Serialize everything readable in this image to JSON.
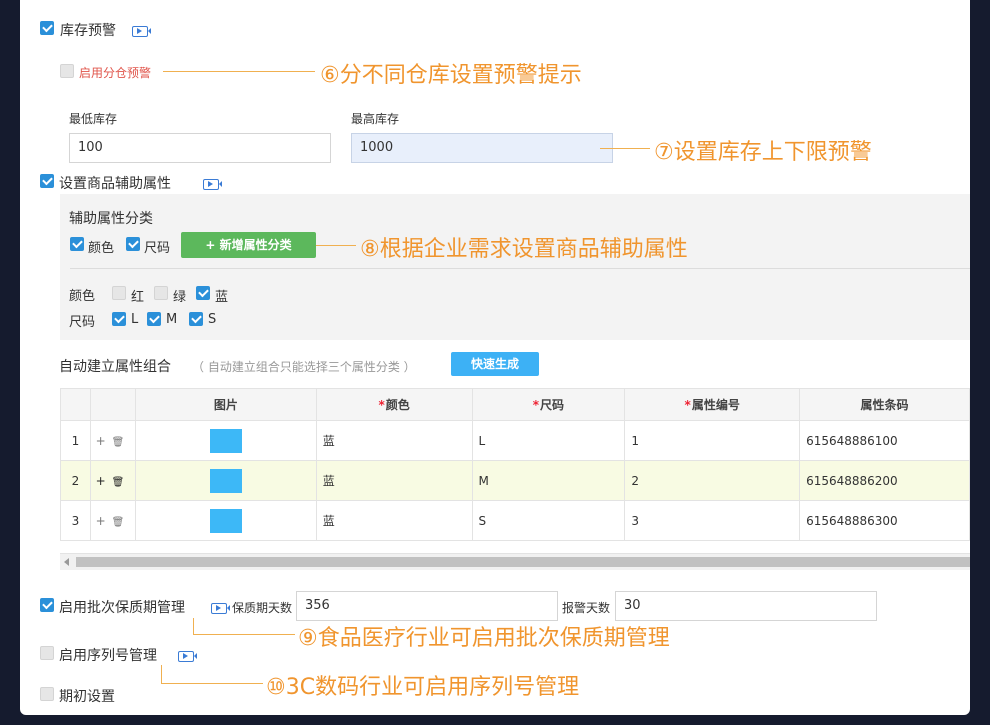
{
  "inventory_alert": {
    "label": "库存预警",
    "checked": true
  },
  "warehouse_alert": {
    "label": "启用分仓预警",
    "checked": false
  },
  "min_stock": {
    "label": "最低库存",
    "value": "100"
  },
  "max_stock": {
    "label": "最高库存",
    "value": "1000"
  },
  "aux_attr": {
    "label": "设置商品辅助属性",
    "checked": true
  },
  "aux_category": {
    "title": "辅助属性分类",
    "options": [
      {
        "label": "颜色",
        "checked": true
      },
      {
        "label": "尺码",
        "checked": true
      }
    ],
    "add_button": "+ 新增属性分类"
  },
  "attr_values": {
    "color": {
      "label": "颜色",
      "values": [
        {
          "label": "红",
          "checked": false
        },
        {
          "label": "绿",
          "checked": false
        },
        {
          "label": "蓝",
          "checked": true
        }
      ]
    },
    "size": {
      "label": "尺码",
      "values": [
        {
          "label": "L",
          "checked": true
        },
        {
          "label": "M",
          "checked": true
        },
        {
          "label": "S",
          "checked": true
        }
      ]
    }
  },
  "auto_combo": {
    "label": "自动建立属性组合",
    "hint": "（ 自动建立组合只能选择三个属性分类 ）",
    "button": "快速生成"
  },
  "table": {
    "headers": {
      "image": "图片",
      "color": "颜色",
      "size": "尺码",
      "code": "属性编号",
      "barcode": "属性条码"
    },
    "required_mark": "*",
    "rows": [
      {
        "index": "1",
        "color": "蓝",
        "size": "L",
        "code": "1",
        "barcode": "615648886100",
        "highlight": false
      },
      {
        "index": "2",
        "color": "蓝",
        "size": "M",
        "code": "2",
        "barcode": "615648886200",
        "highlight": true
      },
      {
        "index": "3",
        "color": "蓝",
        "size": "S",
        "code": "3",
        "barcode": "615648886300",
        "highlight": false
      }
    ],
    "row_ops": {
      "add": "+",
      "delete": "🗑"
    }
  },
  "batch": {
    "label": "启用批次保质期管理",
    "checked": true,
    "shelf_days_label": "保质期天数",
    "shelf_days": "356",
    "alarm_days_label": "报警天数",
    "alarm_days": "30"
  },
  "serial": {
    "label": "启用序列号管理",
    "checked": false
  },
  "opening": {
    "label": "期初设置",
    "checked": false
  },
  "annotations": {
    "a6": "⑥分不同仓库设置预警提示",
    "a7": "⑦设置库存上下限预警",
    "a8": "⑧根据企业需求设置商品辅助属性",
    "a9": "⑨食品医疗行业可启用批次保质期管理",
    "a10": "⑩3C数码行业可启用序列号管理"
  },
  "colors": {
    "accent": "#2b90d9",
    "annotation": "#f0952e",
    "green": "#5cb85c",
    "blue": "#3db1f5",
    "highlight_row": "#f8fbe3"
  },
  "icons": {
    "video": "video-icon",
    "add": "plus-icon",
    "delete": "trash-icon"
  }
}
